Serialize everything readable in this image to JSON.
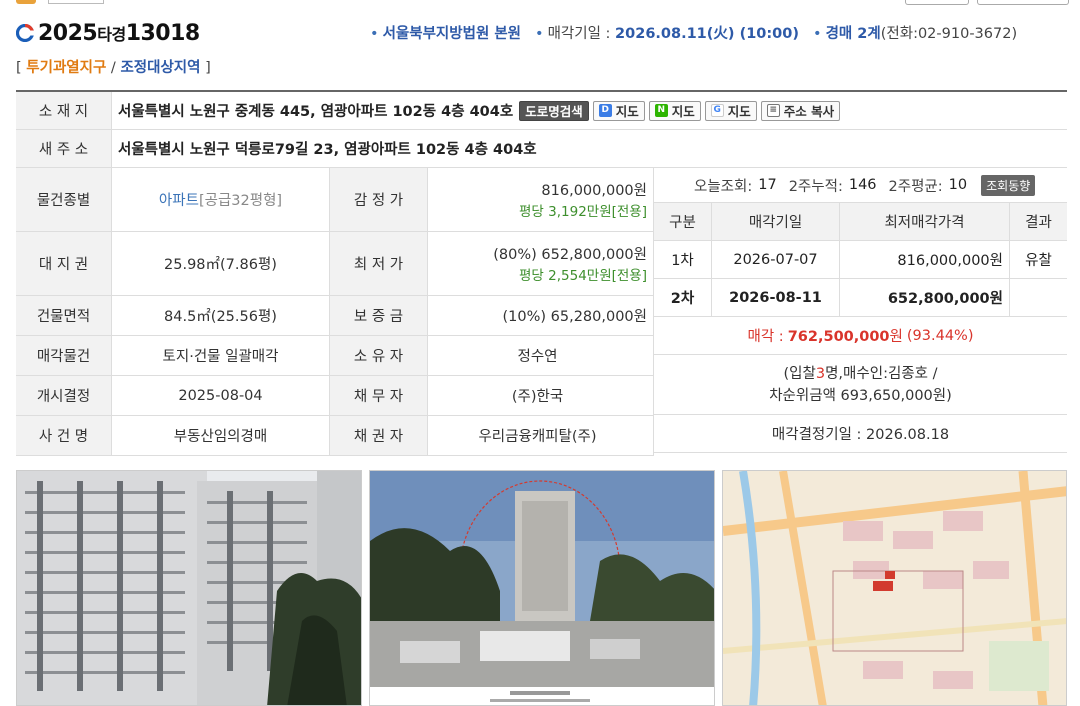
{
  "header": {
    "case_year": "2025",
    "case_type": "타경",
    "case_number": "13018",
    "court": "서울북부지방법원 본원",
    "sale_date_label": "매각기일 : ",
    "sale_date_value": "2026.08.11(火) (10:00)",
    "department": "경매 2계",
    "phone": "(전화:02-910-3672)"
  },
  "zones": {
    "open": "[ ",
    "zone_a": "투기과열지구",
    "sep": " / ",
    "zone_b": "조정대상지역",
    "close": " ]"
  },
  "address": {
    "label": "소 재 지",
    "value": "서울특별시 노원구 중계동 445, 염광아파트 102동 4층 404호",
    "btn_road": "도로명검색",
    "btn_daum": "지도",
    "btn_naver": "지도",
    "btn_google": "지도",
    "btn_copy": "주소 복사"
  },
  "new_address": {
    "label": "새 주 소",
    "value": "서울특별시 노원구 덕릉로79길 23, 염광아파트 102동 4층 404호"
  },
  "details": [
    {
      "l1": "물건종별",
      "v1_main": "아파트",
      "v1_sub": "[공급32평형]",
      "l2": "감 정 가",
      "v2": "816,000,000원",
      "v2_sub": "평당 3,192만원[전용]"
    },
    {
      "l1": "대 지 권",
      "v1_main": "25.98㎡(7.86평)",
      "v1_sub": "",
      "l2": "최 저 가",
      "v2": "(80%) 652,800,000원",
      "v2_sub": "평당 2,554만원[전용]"
    },
    {
      "l1": "건물면적",
      "v1_main": "84.5㎡(25.56평)",
      "v1_sub": "",
      "l2": "보 증 금",
      "v2": "(10%) 65,280,000원",
      "v2_sub": ""
    },
    {
      "l1": "매각물건",
      "v1_main": "토지·건물 일괄매각",
      "v1_sub": "",
      "l2": "소 유 자",
      "v2": "정수연",
      "v2_sub": ""
    },
    {
      "l1": "개시결정",
      "v1_main": "2025-08-04",
      "v1_sub": "",
      "l2": "채 무 자",
      "v2": "(주)한국",
      "v2_sub": ""
    },
    {
      "l1": "사 건 명",
      "v1_main": "부동산임의경매",
      "v1_sub": "",
      "l2": "채 권 자",
      "v2": "우리금융캐피탈(주)",
      "v2_sub": ""
    }
  ],
  "stats": {
    "today_label": "오늘조회:",
    "today_value": "17",
    "two_week_label": "2주누적:",
    "two_week_value": "146",
    "two_week_avg_label": "2주평균:",
    "two_week_avg_value": "10",
    "trend_button": "조회동향"
  },
  "rounds": {
    "headers": [
      "구분",
      "매각기일",
      "최저매각가격",
      "결과"
    ],
    "rows": [
      {
        "round": "1차",
        "date": "2026-07-07",
        "price": "816,000,000원",
        "result": "유찰"
      },
      {
        "round": "2차",
        "date": "2026-08-11",
        "price": "652,800,000원",
        "result": ""
      }
    ]
  },
  "sale": {
    "label": "매각 :",
    "price": "762,500,000",
    "unit": "원",
    "rate": "(93.44%)"
  },
  "bidders": {
    "line1_a": "(입찰",
    "line1_count": "3",
    "line1_b": "명,매수인:김종호 /",
    "line2": "차순위금액 693,650,000원)"
  },
  "decision": "매각결정기일 : 2026.08.18",
  "colors": {
    "accent_blue": "#2e5aa8",
    "accent_orange": "#e07b12",
    "price_red": "#d9342b",
    "green_text": "#3e8f2d"
  },
  "photos": [
    "building-photo",
    "street-photo",
    "map-image"
  ]
}
